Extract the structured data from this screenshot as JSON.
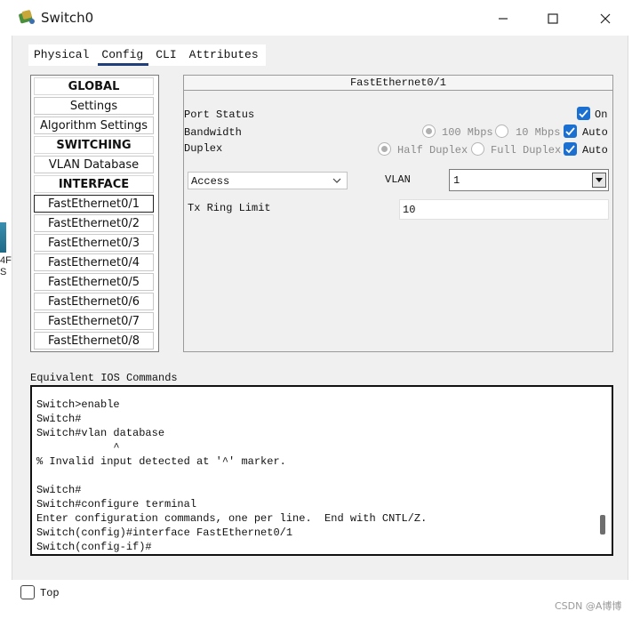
{
  "window": {
    "title": "Switch0",
    "icon": "switch-app-icon",
    "controls": [
      "minimize-icon",
      "maximize-icon",
      "close-icon"
    ]
  },
  "tabs": [
    {
      "label": "Physical",
      "active": false
    },
    {
      "label": "Config",
      "active": true
    },
    {
      "label": "CLI",
      "active": false
    },
    {
      "label": "Attributes",
      "active": false
    }
  ],
  "left_list": {
    "items": [
      {
        "label": "GLOBAL",
        "type": "header"
      },
      {
        "label": "Settings",
        "type": "item"
      },
      {
        "label": "Algorithm Settings",
        "type": "item"
      },
      {
        "label": "SWITCHING",
        "type": "header"
      },
      {
        "label": "VLAN Database",
        "type": "item"
      },
      {
        "label": "INTERFACE",
        "type": "header"
      },
      {
        "label": "FastEthernet0/1",
        "type": "item",
        "selected": true
      },
      {
        "label": "FastEthernet0/2",
        "type": "item"
      },
      {
        "label": "FastEthernet0/3",
        "type": "item"
      },
      {
        "label": "FastEthernet0/4",
        "type": "item"
      },
      {
        "label": "FastEthernet0/5",
        "type": "item"
      },
      {
        "label": "FastEthernet0/6",
        "type": "item"
      },
      {
        "label": "FastEthernet0/7",
        "type": "item"
      },
      {
        "label": "FastEthernet0/8",
        "type": "item"
      }
    ]
  },
  "interface_panel": {
    "title": "FastEthernet0/1",
    "port_status": {
      "label": "Port Status",
      "on_label": "On",
      "checked": true
    },
    "bandwidth": {
      "label": "Bandwidth",
      "opt1": "100 Mbps",
      "opt2": "10 Mbps",
      "auto_label": "Auto",
      "auto_checked": true
    },
    "duplex": {
      "label": "Duplex",
      "opt1": "Half Duplex",
      "opt2": "Full Duplex",
      "auto_label": "Auto",
      "auto_checked": true
    },
    "mode": {
      "value": "Access"
    },
    "vlan": {
      "label": "VLAN",
      "value": "1"
    },
    "tx_ring": {
      "label": "Tx Ring Limit",
      "value": "10"
    }
  },
  "ios": {
    "label": "Equivalent IOS Commands",
    "lines": [
      "Switch>enable",
      "Switch#",
      "Switch#vlan database",
      "            ^",
      "% Invalid input detected at '^' marker.",
      "",
      "Switch#",
      "Switch#configure terminal",
      "Enter configuration commands, one per line.  End with CNTL/Z.",
      "Switch(config)#interface FastEthernet0/1",
      "Switch(config-if)#"
    ]
  },
  "footer": {
    "top_label": "Top",
    "top_checked": false
  },
  "background_fragments": {
    "line1": "4F",
    "line2": "S"
  },
  "watermark": "CSDN @A博博",
  "colors": {
    "accent": "#1a6fd1",
    "tab_underline": "#1f3f7a"
  }
}
